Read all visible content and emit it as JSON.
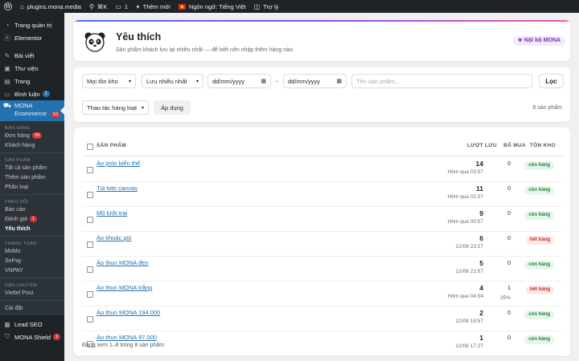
{
  "adminbar": {
    "site": "plugins.mona.media",
    "shortcut": "⌘K",
    "comments": "1",
    "new": "Thêm mới",
    "language": "Ngôn ngữ: Tiếng Việt",
    "help": "Trợ lý"
  },
  "sidebar": {
    "dashboard": "Trang quản trị",
    "elementor": "Elementor",
    "posts": "Bài viết",
    "media": "Thư viện",
    "pages": "Trang",
    "comments": "Bình luận",
    "comments_badge": "1",
    "mona": "MONA Ecommerce",
    "mona_badge": "53",
    "groups": {
      "sales": "BÁN HÀNG",
      "products": "SẢN PHẨM",
      "tracking": "THEO DÕI",
      "payment": "THANH TOÁN",
      "shipping": "VẬN CHUYỂN"
    },
    "orders": "Đơn hàng",
    "orders_badge": "59",
    "customers": "Khách hàng",
    "all_products": "Tất cả sản phẩm",
    "add_product": "Thêm sản phẩm",
    "categories": "Phân loại",
    "reports": "Báo cáo",
    "reviews": "Đánh giá",
    "reviews_badge": "1",
    "favorites": "Yêu thích",
    "momo": "MoMo",
    "sepay": "SePay",
    "vnpay": "VNPAY",
    "viettel": "Viettel Post",
    "settings": "Cài đặt",
    "lead_seo": "Lead SEO",
    "shield": "MONA Shield",
    "shield_badge": "1"
  },
  "header": {
    "title": "Yêu thích",
    "subtitle": "Sản phẩm khách lưu lại nhiều nhất — để biết nên nhập thêm hàng nào.",
    "badge": "★ Nội bộ MONA"
  },
  "filters": {
    "stock": "Mọi tồn kho",
    "sort": "Lưu nhiều nhất",
    "date_from": "dd/mm/yyyy",
    "date_sep": "→",
    "date_to": "dd/mm/yyyy",
    "search_placeholder": "Tên sản phẩm...",
    "filter_button": "Lọc",
    "bulk": "Thao tác hàng loạt",
    "apply": "Áp dụng",
    "count": "8 sản phẩm"
  },
  "table": {
    "headers": {
      "product": "SẢN PHẨM",
      "saves": "LƯỢT LƯU",
      "bought": "ĐÃ MUA",
      "stock": "TỒN KHO"
    },
    "rows": [
      {
        "name": "Áo polo biển thể",
        "saves": "14",
        "last": "Hôm qua 03:57",
        "bought": "0",
        "pct": "",
        "stock": "còn hàng",
        "in_stock": true
      },
      {
        "name": "Túi tote canvas",
        "saves": "11",
        "last": "Hôm qua 02:27",
        "bought": "0",
        "pct": "",
        "stock": "còn hàng",
        "in_stock": true
      },
      {
        "name": "Mũ lưỡi trai",
        "saves": "9",
        "last": "Hôm qua 00:57",
        "bought": "0",
        "pct": "",
        "stock": "còn hàng",
        "in_stock": true
      },
      {
        "name": "Áo khoác gió",
        "saves": "6",
        "last": "12/08 23:27",
        "bought": "0",
        "pct": "",
        "stock": "hết hàng",
        "in_stock": false
      },
      {
        "name": "Áo thun MONA đen",
        "saves": "5",
        "last": "12/08 21:57",
        "bought": "0",
        "pct": "",
        "stock": "còn hàng",
        "in_stock": true
      },
      {
        "name": "Áo thun MONA trắng",
        "saves": "4",
        "last": "Hôm qua 04:04",
        "bought": "1",
        "pct": "25%",
        "stock": "hết hàng",
        "in_stock": false
      },
      {
        "name": "Áo thun MONA 194.000",
        "saves": "2",
        "last": "12/08 18:57",
        "bought": "0",
        "pct": "",
        "stock": "còn hàng",
        "in_stock": true
      },
      {
        "name": "Áo thun MONA 97.000",
        "saves": "1",
        "last": "12/08 17:27",
        "bought": "0",
        "pct": "",
        "stock": "còn hàng",
        "in_stock": true
      }
    ],
    "footer": "Đang xem 1–8 trong 8 sản phẩm"
  }
}
